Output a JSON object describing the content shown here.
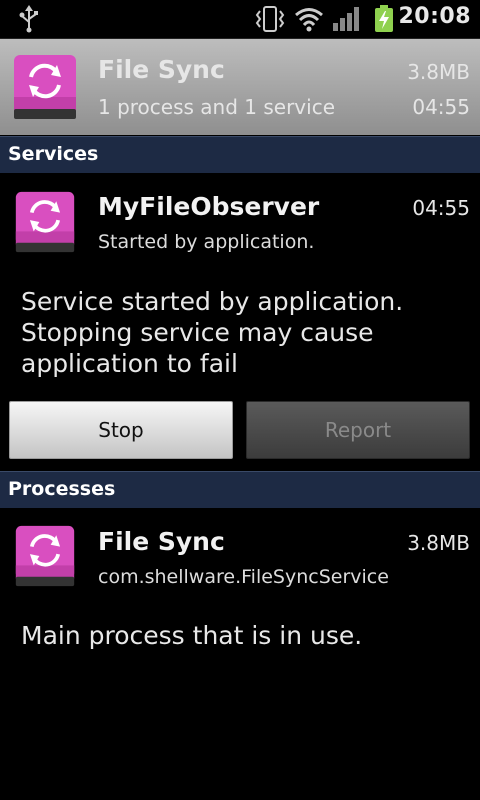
{
  "statusbar": {
    "time": "20:08"
  },
  "header": {
    "app_name": "File Sync",
    "summary": "1 process and 1 service",
    "size": "3.8MB",
    "elapsed": "04:55"
  },
  "services_section": {
    "label": "Services"
  },
  "service": {
    "name": "MyFileObserver",
    "elapsed": "04:55",
    "subtitle": "Started by application.",
    "description_line1": "Service started by application.",
    "description_line2": "Stopping service may cause",
    "description_line3": "application to fail"
  },
  "buttons": {
    "stop_label": "Stop",
    "report_label": "Report"
  },
  "processes_section": {
    "label": "Processes"
  },
  "process": {
    "name": "File Sync",
    "size": "3.8MB",
    "package": "com.shellware.FileSyncService",
    "description": "Main process that is in use."
  },
  "colors": {
    "accent_pink": "#d94fc0",
    "section_bg": "#1d2a44",
    "header_bg": "#a8a8a8"
  },
  "icons": [
    "usb-icon",
    "vibrate-icon",
    "wifi-icon",
    "signal-icon",
    "battery-charging-icon",
    "file-sync-app-icon"
  ]
}
